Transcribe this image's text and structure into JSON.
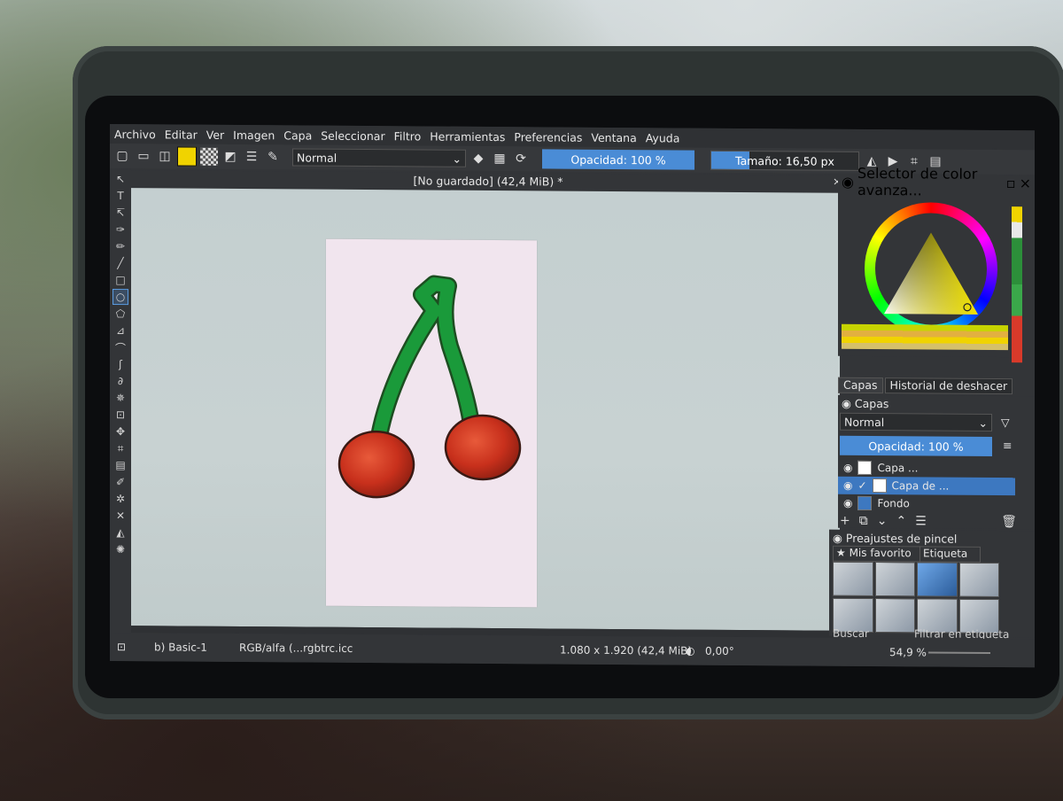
{
  "menu": [
    "Archivo",
    "Editar",
    "Ver",
    "Imagen",
    "Capa",
    "Seleccionar",
    "Filtro",
    "Herramientas",
    "Preferencias",
    "Ventana",
    "Ayuda"
  ],
  "toolbar": {
    "blend_mode": "Normal",
    "opacity_label": "Opacidad: 100 %",
    "size_label": "Tamaño: 16,50 px",
    "size_fraction": 0.26
  },
  "document": {
    "title": "[No guardado]  (42,4 MiB) *",
    "close": "×"
  },
  "docker_color": {
    "title": "Selector de color avanza...",
    "accent": "#f0d300"
  },
  "tabs": [
    "Capas",
    "Historial de deshacer"
  ],
  "layers_panel": {
    "title": "Capas",
    "blend_mode": "Normal",
    "opacity_label": "Opacidad:  100 %",
    "layers": [
      {
        "name": "Capa ...",
        "selected": false
      },
      {
        "name": "Capa de ...",
        "selected": true
      },
      {
        "name": "Fondo",
        "selected": false
      }
    ]
  },
  "presets": {
    "title": "Preajustes de pincel",
    "favorites": "Mis favorito",
    "tag_label": "Etiqueta",
    "search_placeholder": "Buscar",
    "filter_label": "Filtrar en etiqueta"
  },
  "status": {
    "preset": "b) Basic-1",
    "color_profile": "RGB/alfa (...rgbtrc.icc",
    "dimensions": "1.080 x 1.920 (42,4 MiB)",
    "rotation": "0,00°",
    "zoom": "54,9 %"
  }
}
